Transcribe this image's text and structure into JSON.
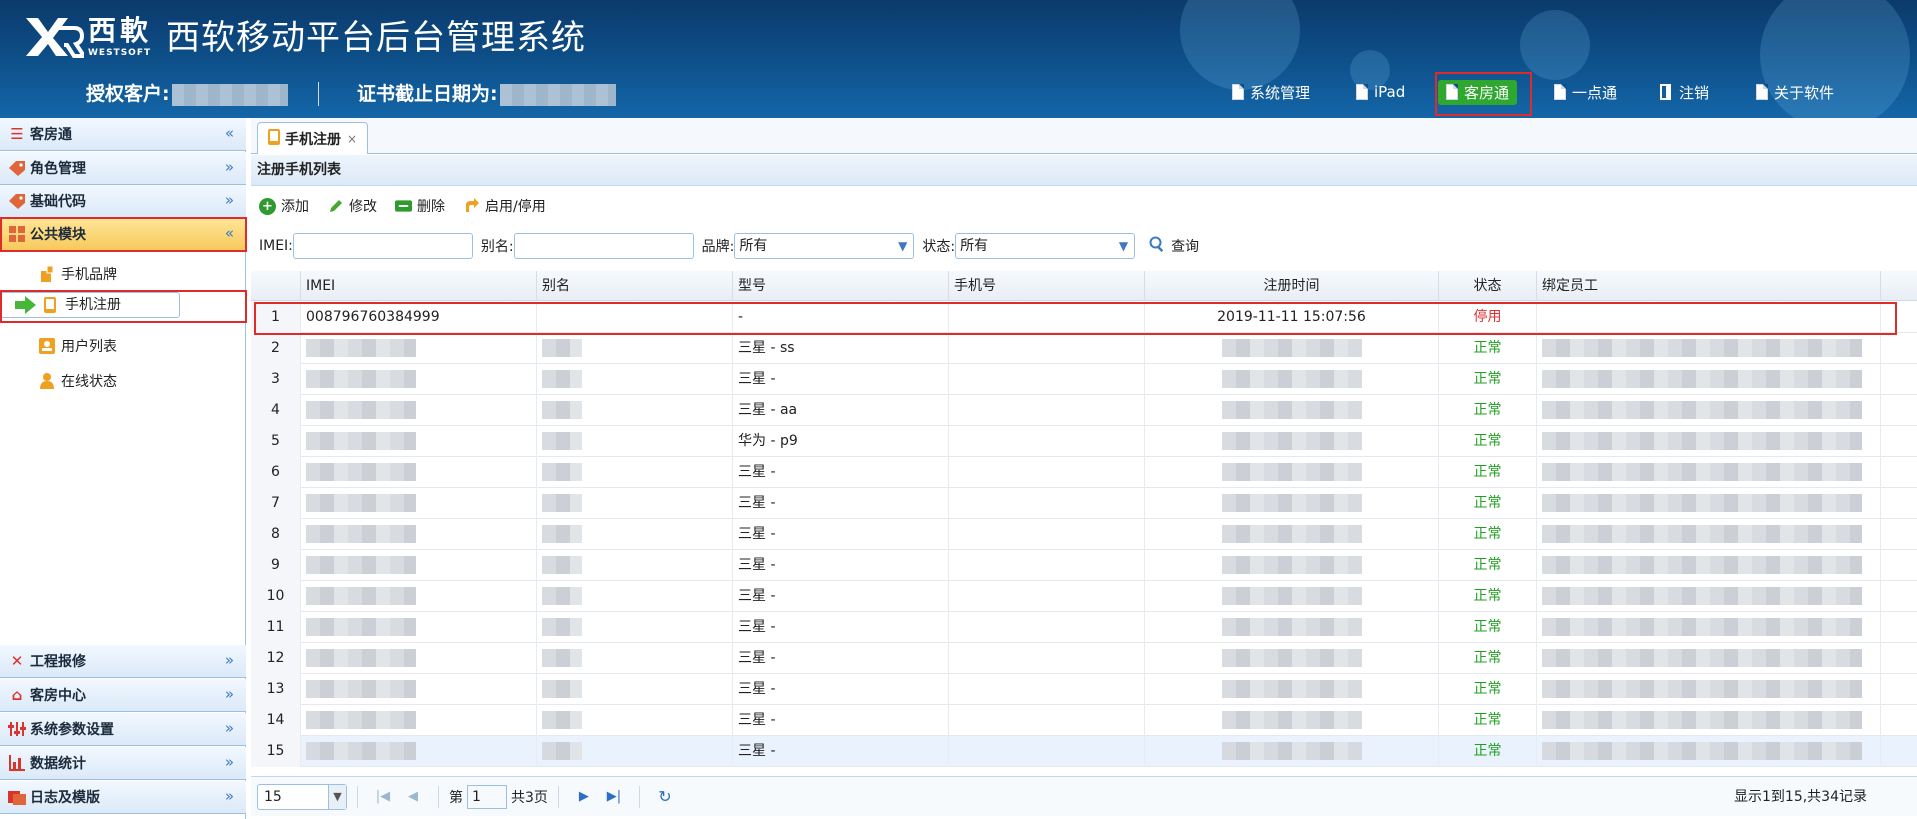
{
  "brand": {
    "cn": "西軟",
    "en": "WESTSOFT",
    "title": "西软移动平台后台管理系统"
  },
  "license": {
    "customer_label": "授权客户:",
    "cert_label": "证书截止日期为:"
  },
  "topnav": [
    {
      "label": "系统管理",
      "icon": "document-icon"
    },
    {
      "label": "iPad",
      "icon": "document-icon"
    },
    {
      "label": "客房通",
      "icon": "document-icon",
      "active": true
    },
    {
      "label": "一点通",
      "icon": "document-icon"
    },
    {
      "label": "注销",
      "icon": "logout-icon"
    },
    {
      "label": "关于软件",
      "icon": "document-icon"
    }
  ],
  "sidebar": {
    "sections": [
      {
        "label": "客房通",
        "icon": "list-icon",
        "chev": "«"
      },
      {
        "label": "角色管理",
        "icon": "tag-icon",
        "chev": "»"
      },
      {
        "label": "基础代码",
        "icon": "tag-icon",
        "chev": "»"
      },
      {
        "label": "公共模块",
        "icon": "grid-icon",
        "chev": "«",
        "active": true
      },
      {
        "label": "工程报修",
        "icon": "tools-icon",
        "chev": "»"
      },
      {
        "label": "客房中心",
        "icon": "house-icon",
        "chev": "»"
      },
      {
        "label": "系统参数设置",
        "icon": "sliders-icon",
        "chev": "»"
      },
      {
        "label": "数据统计",
        "icon": "bar-chart-icon",
        "chev": "»"
      },
      {
        "label": "日志及模版",
        "icon": "folder-icon",
        "chev": "»"
      }
    ],
    "items": [
      {
        "label": "手机品牌"
      },
      {
        "label": "手机注册",
        "selected": true
      },
      {
        "label": "用户列表"
      },
      {
        "label": "在线状态"
      }
    ]
  },
  "tab": {
    "label": "手机注册",
    "close": "×"
  },
  "panel_title": "注册手机列表",
  "toolbar": {
    "add": "添加",
    "edit": "修改",
    "delete": "删除",
    "toggle": "启用/停用"
  },
  "filters": {
    "imei_label": "IMEI:",
    "alias_label": "别名:",
    "brand_label": "品牌:",
    "brand_value": "所有",
    "status_label": "状态:",
    "status_value": "所有",
    "search": "查询"
  },
  "columns": [
    "IMEI",
    "别名",
    "型号",
    "手机号",
    "注册时间",
    "状态",
    "绑定员工"
  ],
  "rows": [
    {
      "n": "1",
      "imei": "008796760384999",
      "alias": "",
      "model": "-",
      "phone": "",
      "time": "2019-11-11 15:07:56",
      "status": "停用",
      "staff": ""
    },
    {
      "n": "2",
      "model": "三星 - ss",
      "status": "正常"
    },
    {
      "n": "3",
      "model": "三星 -",
      "status": "正常"
    },
    {
      "n": "4",
      "model": "三星 - aa",
      "status": "正常"
    },
    {
      "n": "5",
      "model": "华为 - p9",
      "status": "正常"
    },
    {
      "n": "6",
      "model": "三星 -",
      "status": "正常"
    },
    {
      "n": "7",
      "model": "三星 -",
      "status": "正常"
    },
    {
      "n": "8",
      "model": "三星 -",
      "status": "正常"
    },
    {
      "n": "9",
      "model": "三星 -",
      "status": "正常"
    },
    {
      "n": "10",
      "model": "三星 -",
      "status": "正常"
    },
    {
      "n": "11",
      "model": "三星 -",
      "status": "正常"
    },
    {
      "n": "12",
      "model": "三星 -",
      "status": "正常"
    },
    {
      "n": "13",
      "model": "三星 -",
      "status": "正常"
    },
    {
      "n": "14",
      "model": "三星 -",
      "status": "正常"
    },
    {
      "n": "15",
      "model": "三星 -",
      "status": "正常"
    }
  ],
  "pager": {
    "page_size": "15",
    "page_prefix": "第",
    "page_value": "1",
    "page_suffix": "共3页",
    "info": "显示1到15,共34记录"
  },
  "colors": {
    "header": "#0d4d86",
    "active_nav": "#2fa82f",
    "status_ok": "#20a020",
    "status_off": "#e03030",
    "highlight": "#e02b2b"
  }
}
